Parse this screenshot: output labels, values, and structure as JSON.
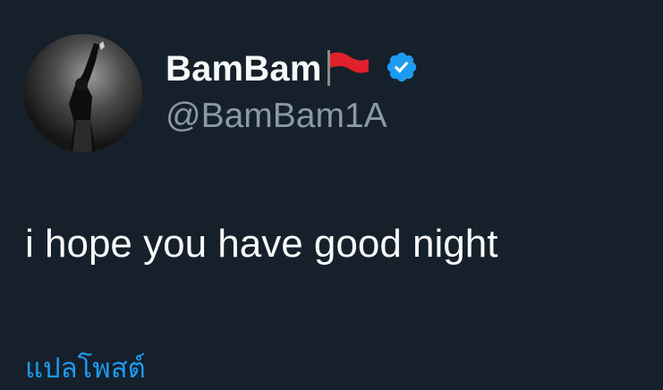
{
  "author": {
    "display_name": "BamBam",
    "handle": "@BamBam1A",
    "avatar_icon": "profile-photo",
    "name_emoji_icon": "red-flag-icon",
    "verified_icon": "verified-badge-icon",
    "verified_color": "#1d9bf0"
  },
  "tweet": {
    "text": "i hope you have good night"
  },
  "translate": {
    "label": "แปลโพสต์"
  },
  "colors": {
    "background": "#15202b",
    "primary_text": "#f7f9f9",
    "secondary_text": "#8b98a5",
    "link": "#1d9bf0"
  }
}
